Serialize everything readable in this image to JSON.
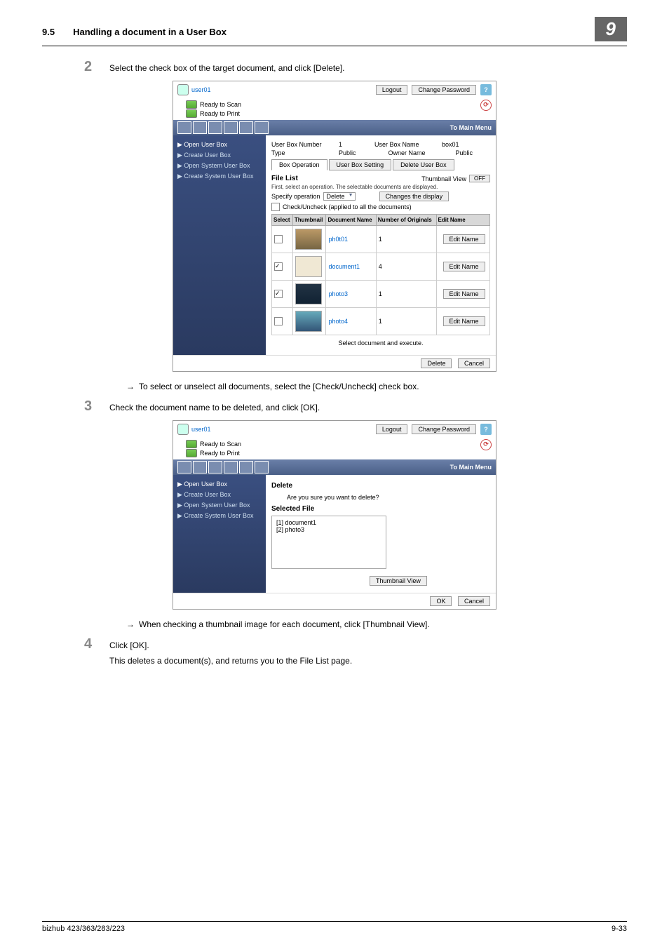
{
  "header": {
    "section": "9.5",
    "title": "Handling a document in a User Box",
    "badge": "9"
  },
  "steps": {
    "s2": {
      "num": "2",
      "txt": "Select the check box of the target document, and click [Delete]."
    },
    "s3": {
      "num": "3",
      "txt": "Check the document name to be deleted, and click [OK]."
    },
    "s4": {
      "num": "4",
      "txt": "Click [OK].",
      "extra": "This deletes a document(s), and returns you to the File List page."
    }
  },
  "notes": {
    "n1": "To select or unselect all documents, select the [Check/Uncheck] check box.",
    "n2": "When checking a thumbnail image for each document, click [Thumbnail View]."
  },
  "ui": {
    "user": "user01",
    "logout": "Logout",
    "chpass": "Change Password",
    "ready_scan": "Ready to Scan",
    "ready_print": "Ready to Print",
    "tomain": "To Main Menu",
    "nav": {
      "open": "Open User Box",
      "create": "Create User Box",
      "opensys": "Open System User Box",
      "createsys": "Create System User Box"
    },
    "boxinfo": {
      "num_l": "User Box Number",
      "num_v": "1",
      "name_l": "User Box Name",
      "name_v": "box01",
      "type_l": "Type",
      "type_v": "Public",
      "owner_l": "Owner Name",
      "owner_v": "Public"
    },
    "tabs": {
      "op": "Box Operation",
      "setting": "User Box Setting",
      "del": "Delete User Box"
    },
    "filelist": {
      "hdr": "File List",
      "thumbview": "Thumbnail View",
      "off": "OFF",
      "line1": "First, select an operation. The selectable documents are displayed.",
      "spec": "Specify operation",
      "specval": "Delete",
      "change": "Changes the display",
      "chkall": "Check/Uncheck (applied to all the documents)"
    },
    "cols": {
      "sel": "Select",
      "thumb": "Thumbnail",
      "name": "Document Name",
      "num": "Number of Originals",
      "edit": "Edit Name"
    },
    "rows": [
      {
        "chk": false,
        "name": "ph0t01",
        "num": "1"
      },
      {
        "chk": true,
        "name": "document1",
        "num": "4"
      },
      {
        "chk": true,
        "name": "photo3",
        "num": "1"
      },
      {
        "chk": false,
        "name": "photo4",
        "num": "1"
      }
    ],
    "editbtn": "Edit Name",
    "execute": "Select document and execute.",
    "delete": "Delete",
    "cancel": "Cancel",
    "ok": "OK",
    "confirm": {
      "hdr": "Delete",
      "q": "Are you sure you want to delete?",
      "selfile": "Selected File",
      "f1": "[1] document1",
      "f2": "[2] photo3",
      "thumb": "Thumbnail View"
    }
  },
  "footer": {
    "left": "bizhub 423/363/283/223",
    "right": "9-33"
  }
}
